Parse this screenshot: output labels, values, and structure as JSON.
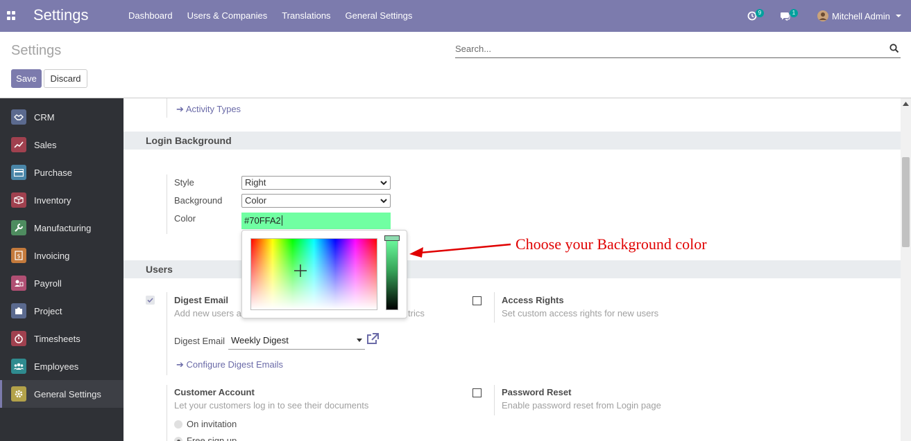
{
  "navbar": {
    "brand": "Settings",
    "menu": [
      "Dashboard",
      "Users & Companies",
      "Translations",
      "General Settings"
    ],
    "activity_count": "9",
    "message_count": "1",
    "user_name": "Mitchell Admin"
  },
  "control_panel": {
    "title": "Settings",
    "search_placeholder": "Search...",
    "save_label": "Save",
    "discard_label": "Discard"
  },
  "sidebar": {
    "items": [
      {
        "label": "CRM",
        "color": "#5b6a8f"
      },
      {
        "label": "Sales",
        "color": "#a0414f"
      },
      {
        "label": "Purchase",
        "color": "#4a86a8"
      },
      {
        "label": "Inventory",
        "color": "#a0414f"
      },
      {
        "label": "Manufacturing",
        "color": "#4e8c5f"
      },
      {
        "label": "Invoicing",
        "color": "#c47a3c"
      },
      {
        "label": "Payroll",
        "color": "#b04f73"
      },
      {
        "label": "Project",
        "color": "#5b6a8f"
      },
      {
        "label": "Timesheets",
        "color": "#a0414f"
      },
      {
        "label": "Employees",
        "color": "#2f8b8f"
      },
      {
        "label": "General Settings",
        "color": "#b3a24a"
      }
    ],
    "active": "General Settings"
  },
  "content": {
    "activity_types_link": "Activity Types",
    "login_background": {
      "heading": "Login Background",
      "style_label": "Style",
      "style_value": "Right",
      "background_label": "Background",
      "background_value": "Color",
      "color_label": "Color",
      "color_value": "#70FFA2"
    },
    "users": {
      "heading": "Users",
      "digest_email_title": "Digest Email",
      "digest_email_desc": "Add new users a",
      "digest_email_desc_tail": "trics",
      "digest_field_label": "Digest Email",
      "digest_field_value": "Weekly Digest",
      "configure_link": "Configure Digest Emails",
      "access_rights_title": "Access Rights",
      "access_rights_desc": "Set custom access rights for new users",
      "customer_account_title": "Customer Account",
      "customer_account_desc": "Let your customers log in to see their documents",
      "radio_on_invitation": "On invitation",
      "radio_free_signup": "Free sign up",
      "password_reset_title": "Password Reset",
      "password_reset_desc": "Enable password reset from Login page"
    }
  },
  "annotation": {
    "text": "Choose your Background color",
    "color": "#e00000"
  },
  "colors": {
    "brand": "#7c7bad",
    "picked": "#70ffa2"
  }
}
